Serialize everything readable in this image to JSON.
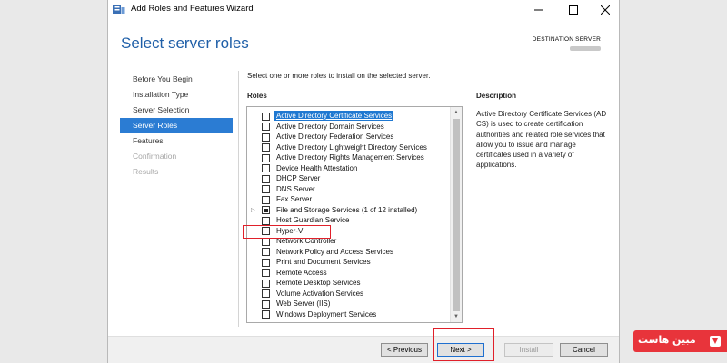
{
  "window": {
    "title": "Add Roles and Features Wizard",
    "minimize_icon": "minimize-icon",
    "maximize_icon": "maximize-icon",
    "close_icon": "close-icon"
  },
  "header": {
    "page_title": "Select server roles",
    "destination_label": "DESTINATION SERVER"
  },
  "nav": {
    "items": [
      {
        "label": "Before You Begin",
        "state": "normal"
      },
      {
        "label": "Installation Type",
        "state": "normal"
      },
      {
        "label": "Server Selection",
        "state": "normal"
      },
      {
        "label": "Server Roles",
        "state": "active"
      },
      {
        "label": "Features",
        "state": "normal"
      },
      {
        "label": "Confirmation",
        "state": "disabled"
      },
      {
        "label": "Results",
        "state": "disabled"
      }
    ]
  },
  "main": {
    "instruction": "Select one or more roles to install on the selected server.",
    "roles_heading": "Roles",
    "description_heading": "Description",
    "description_text": "Active Directory Certificate Services (AD CS) is used to create certification authorities and related role services that allow you to issue and manage certificates used in a variety of applications.",
    "roles": [
      {
        "label": "Active Directory Certificate Services",
        "checked": false,
        "selected": true,
        "expandable": false
      },
      {
        "label": "Active Directory Domain Services",
        "checked": false,
        "selected": false,
        "expandable": false
      },
      {
        "label": "Active Directory Federation Services",
        "checked": false,
        "selected": false,
        "expandable": false
      },
      {
        "label": "Active Directory Lightweight Directory Services",
        "checked": false,
        "selected": false,
        "expandable": false
      },
      {
        "label": "Active Directory Rights Management Services",
        "checked": false,
        "selected": false,
        "expandable": false
      },
      {
        "label": "Device Health Attestation",
        "checked": false,
        "selected": false,
        "expandable": false
      },
      {
        "label": "DHCP Server",
        "checked": false,
        "selected": false,
        "expandable": false
      },
      {
        "label": "DNS Server",
        "checked": false,
        "selected": false,
        "expandable": false
      },
      {
        "label": "Fax Server",
        "checked": false,
        "selected": false,
        "expandable": false
      },
      {
        "label": "File and Storage Services (1 of 12 installed)",
        "checked": "partial",
        "selected": false,
        "expandable": true
      },
      {
        "label": "Host Guardian Service",
        "checked": false,
        "selected": false,
        "expandable": false
      },
      {
        "label": "Hyper-V",
        "checked": false,
        "selected": false,
        "expandable": false
      },
      {
        "label": "Network Controller",
        "checked": false,
        "selected": false,
        "expandable": false
      },
      {
        "label": "Network Policy and Access Services",
        "checked": false,
        "selected": false,
        "expandable": false
      },
      {
        "label": "Print and Document Services",
        "checked": false,
        "selected": false,
        "expandable": false
      },
      {
        "label": "Remote Access",
        "checked": false,
        "selected": false,
        "expandable": false
      },
      {
        "label": "Remote Desktop Services",
        "checked": false,
        "selected": false,
        "expandable": false
      },
      {
        "label": "Volume Activation Services",
        "checked": false,
        "selected": false,
        "expandable": false
      },
      {
        "label": "Web Server (IIS)",
        "checked": false,
        "selected": false,
        "expandable": false
      },
      {
        "label": "Windows Deployment Services",
        "checked": false,
        "selected": false,
        "expandable": false
      }
    ]
  },
  "buttons": {
    "previous": "< Previous",
    "next": "Next >",
    "install": "Install",
    "cancel": "Cancel"
  },
  "watermark": {
    "text": "مبین هاست",
    "color": "#e8343b"
  },
  "colors": {
    "accent": "#2b7cd3",
    "title_blue": "#1f5fa8",
    "highlight_red": "#e0202a"
  }
}
